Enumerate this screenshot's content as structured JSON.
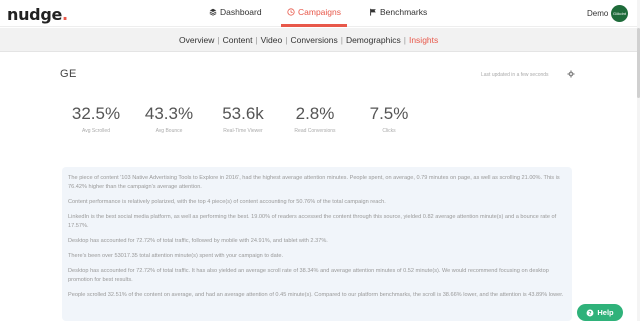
{
  "app": {
    "logo": "nudge",
    "logo_dot": "."
  },
  "nav": {
    "tabs": [
      {
        "label": "Dashboard",
        "icon": "layers-icon"
      },
      {
        "label": "Campaigns",
        "icon": "clock-icon",
        "active": true
      },
      {
        "label": "Benchmarks",
        "icon": "flag-icon"
      }
    ],
    "user_name": "Demo",
    "avatar_text": "Gökdnt"
  },
  "subnav": {
    "items": [
      "Overview",
      "Content",
      "Video",
      "Conversions",
      "Demographics",
      "Insights"
    ],
    "active": "Insights"
  },
  "page": {
    "title": "GE",
    "last_updated": "Last updated in a few seconds"
  },
  "stats": [
    {
      "value": "32.5%",
      "label": "Avg Scrolled"
    },
    {
      "value": "43.3%",
      "label": "Avg Bounce"
    },
    {
      "value": "53.6k",
      "label": "Real-Time Viewer"
    },
    {
      "value": "2.8%",
      "label": "Read Conversions"
    },
    {
      "value": "7.5%",
      "label": "Clicks"
    }
  ],
  "insights": [
    "The piece of content '103 Native Advertising Tools to Explore in 2016', had the highest average attention minutes. People spent, on average, 0.79 minutes on page, as well as scrolling 21.00%. This is 76.42% higher than the campaign's average attention.",
    "Content performance is relatively polarized, with the top 4 piece(s) of content accounting for 50.76% of the total campaign reach.",
    "LinkedIn is the best social media platform, as well as performing the best. 19.00% of readers accessed the content through this source, yielded 0.82 average attention minute(s) and a bounce rate of 17.57%.",
    "Desktop has accounted for 72.72% of total traffic, followed by mobile with 24.91%, and tablet with 2.37%.",
    "There's been over 53017.35 total attention minute(s) spent with your campaign to date.",
    "Desktop has accounted for 72.72% of total traffic. It has also yielded an average scroll rate of 38.34% and average attention minutes of 0.52 minute(s). We would recommend focusing on desktop promotion for best results.",
    "People scrolled 32.51% of the content on average, and had an average attention of 0.45 minute(s). Compared to our platform benchmarks, the scroll is 38.66% lower, and the attention is 43.89% lower."
  ],
  "help": {
    "label": "Help"
  },
  "colors": {
    "accent": "#e8584a",
    "help": "#2fb27a",
    "insights_bg": "#f1f5fa"
  }
}
